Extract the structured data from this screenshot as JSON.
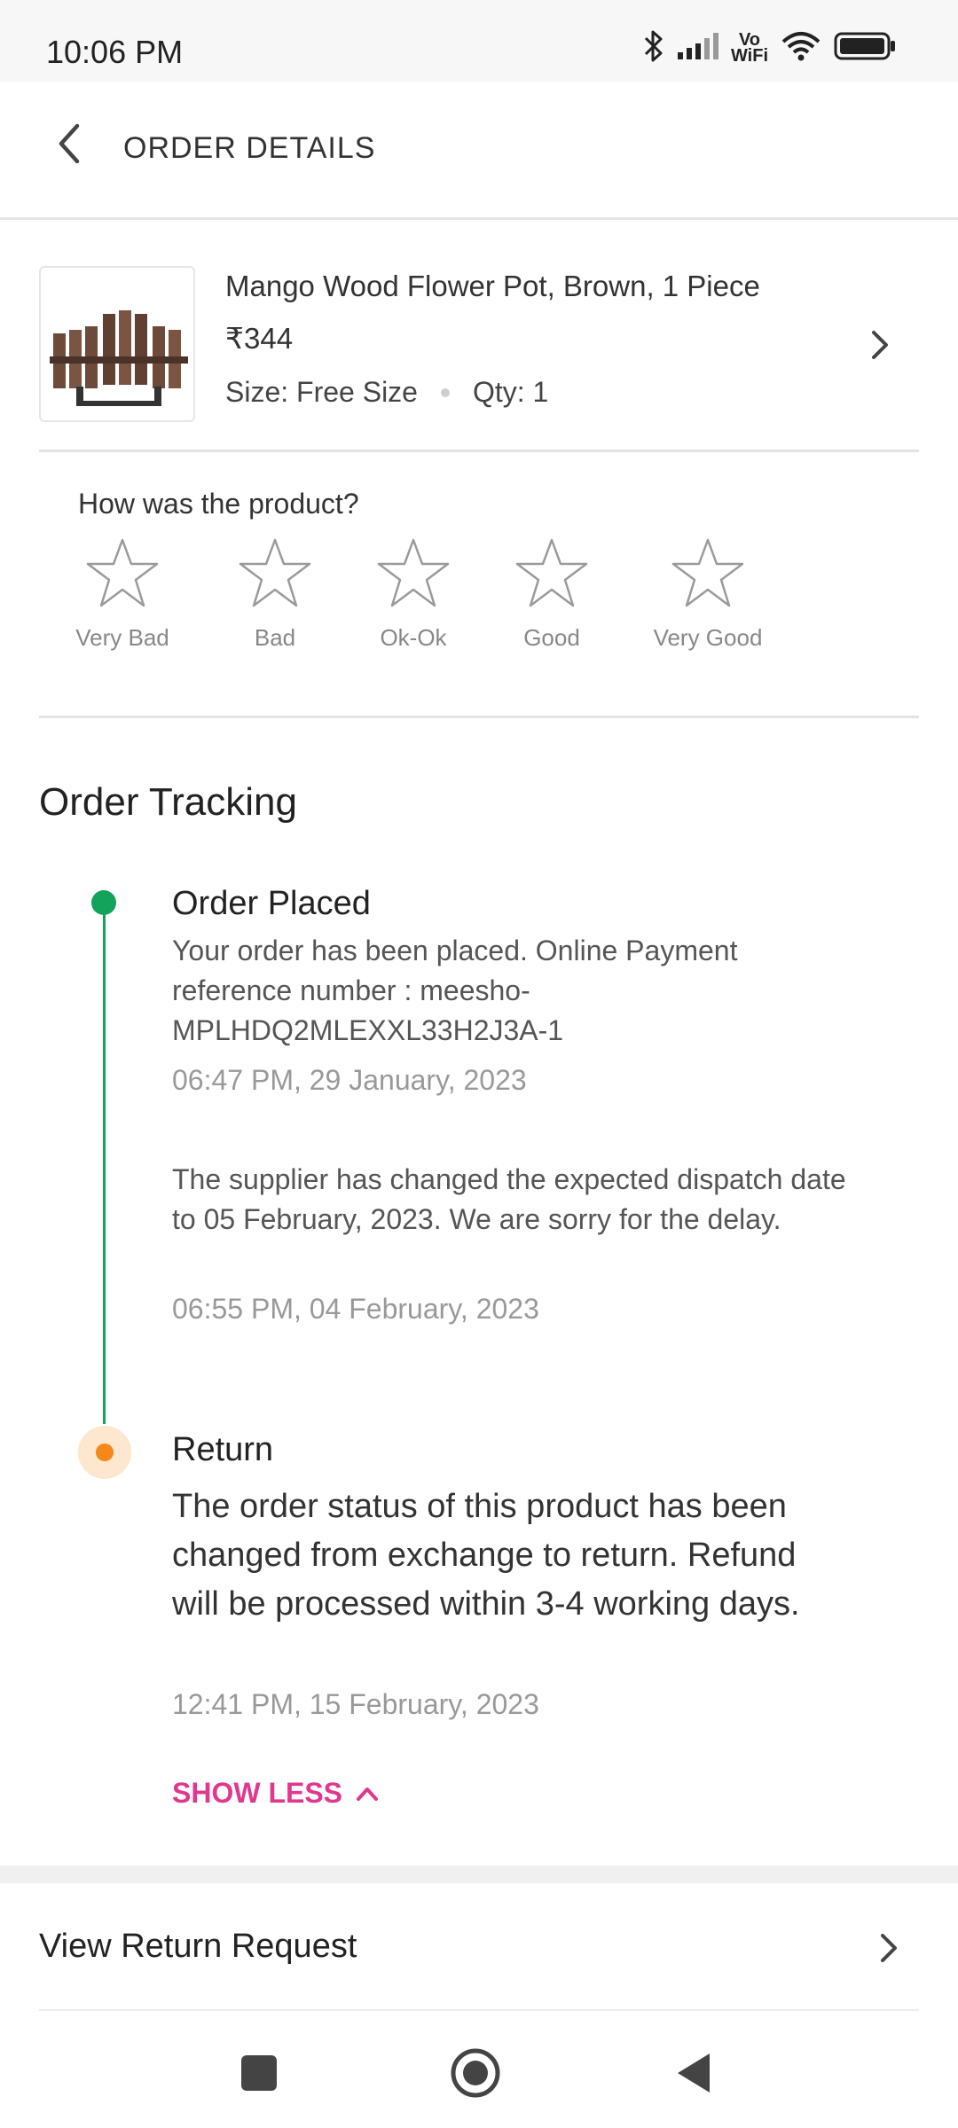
{
  "status_bar": {
    "time": "10:06 PM",
    "icons": [
      "bluetooth-icon",
      "signal-icon",
      "vowifi-icon",
      "wifi-icon",
      "battery-icon"
    ],
    "vowifi_top": "Vo",
    "vowifi_bottom": "WiFi"
  },
  "app_bar": {
    "title": "ORDER DETAILS",
    "back_icon": "back-arrow-icon"
  },
  "product": {
    "name": "Mango Wood Flower Pot, Brown, 1 Piece",
    "price": "₹344",
    "size": "Size: Free Size",
    "qty": "Qty: 1",
    "chevron_icon": "chevron-right-icon"
  },
  "rating": {
    "question": "How was the product?",
    "options": [
      "Very Bad",
      "Bad",
      "Ok-Ok",
      "Good",
      "Very Good"
    ],
    "selected": 0
  },
  "tracking": {
    "title": "Order Tracking",
    "events": [
      {
        "heading": "Order Placed",
        "body": "Your order has been placed. Online Payment reference number : meesho-MPLHDQ2MLEXXL33H2J3A-1",
        "time": "06:47 PM, 29 January, 2023",
        "status_color": "#13a35b"
      },
      {
        "body": "The supplier has changed the expected dispatch date to 05 February, 2023. We are sorry for the delay.",
        "time": "06:55 PM, 04 February, 2023"
      },
      {
        "heading": "Return",
        "body": "The order status of this product has been changed from exchange to return. Refund will be processed within 3-4 working days.",
        "time": "12:41 PM, 15 February, 2023",
        "status_color": "#f7861b"
      }
    ],
    "toggle_label": "SHOW LESS",
    "accent_color": "#e0388f"
  },
  "view_return": {
    "label": "View Return Request"
  },
  "nav": {
    "icons": [
      "recents-square-icon",
      "home-circle-icon",
      "back-triangle-icon"
    ]
  }
}
